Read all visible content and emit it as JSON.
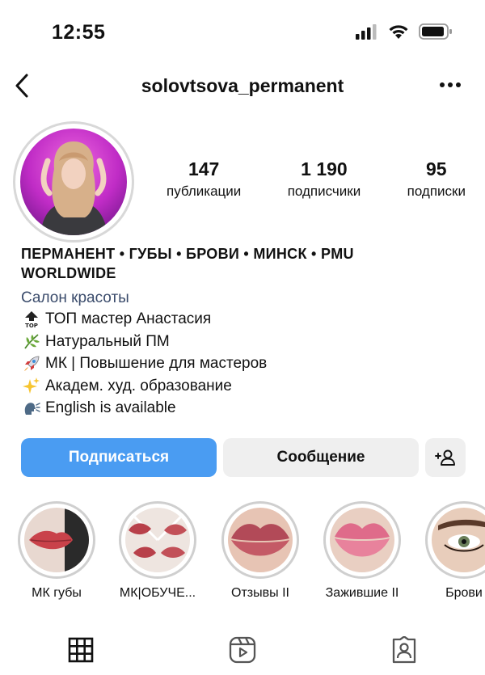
{
  "status_bar": {
    "time": "12:55"
  },
  "header": {
    "username": "solovtsova_permanent"
  },
  "stats": [
    {
      "value": "147",
      "label": "публикации"
    },
    {
      "value": "1 190",
      "label": "подписчики"
    },
    {
      "value": "95",
      "label": "подписки"
    }
  ],
  "bio": {
    "name_line1": "ПЕРМАНЕНТ • ГУБЫ • БРОВИ • МИНСК • PMU",
    "name_line2": "WORLDWIDE",
    "category": "Салон красоты",
    "lines": [
      {
        "icon": "top-arrow-icon",
        "text": "ТОП мастер Анастасия"
      },
      {
        "icon": "herb-icon",
        "text": "Натуральный ПМ"
      },
      {
        "icon": "rocket-icon",
        "text": "МК | Повышение для мастеров"
      },
      {
        "icon": "sparkles-icon",
        "text": "Академ. худ. образование"
      },
      {
        "icon": "speaking-head-icon",
        "text": "English is available"
      }
    ]
  },
  "buttons": {
    "follow": "Подписаться",
    "message": "Сообщение"
  },
  "highlights": [
    {
      "label": "МК губы"
    },
    {
      "label": "МК|ОБУЧЕ..."
    },
    {
      "label": "Отзывы II"
    },
    {
      "label": "Зажившие II"
    },
    {
      "label": "Брови"
    }
  ],
  "colors": {
    "accent": "#4a9cf2",
    "category": "#3a4b6b",
    "button_gray": "#efefef"
  }
}
